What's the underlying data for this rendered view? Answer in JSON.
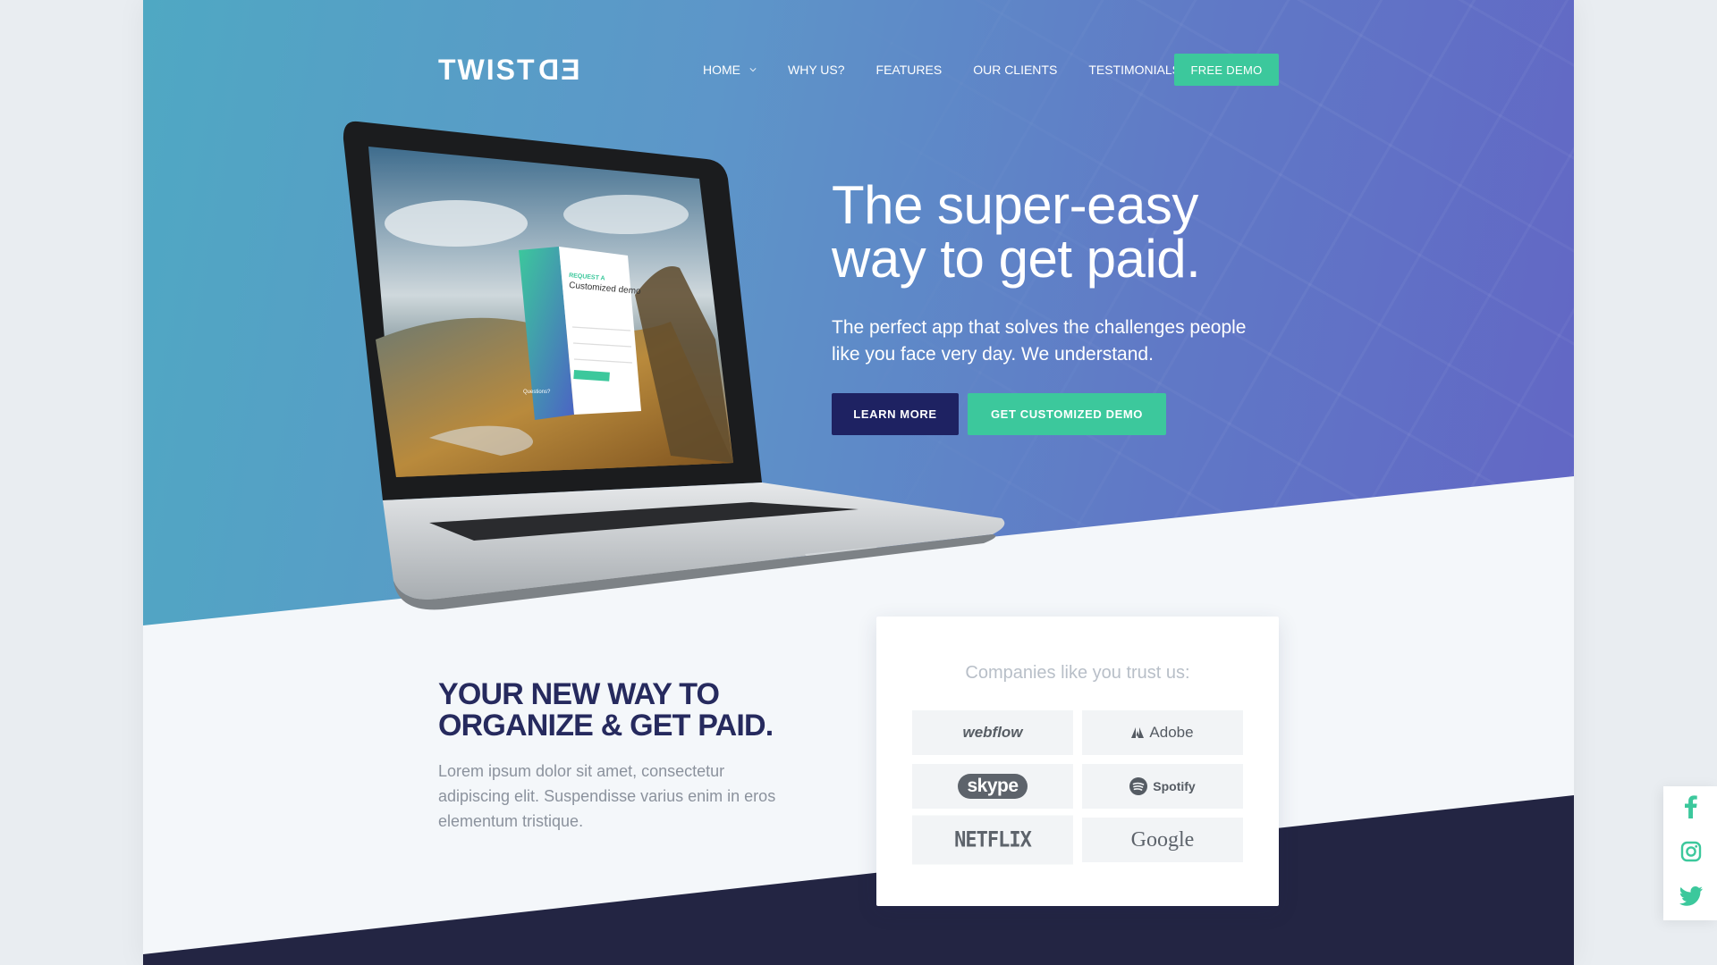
{
  "brand": {
    "logo_prefix": "TWIST",
    "logo_flipped": "ED"
  },
  "nav": {
    "items": [
      "HOME",
      "WHY US?",
      "FEATURES",
      "OUR CLIENTS",
      "TESTIMONIALS"
    ],
    "cta": "FREE DEMO"
  },
  "hero": {
    "title_line1": "The super-easy",
    "title_line2": "way to get paid.",
    "subtitle": "The perfect app that solves the challenges people like you face very day. We understand.",
    "learn_more": "LEARN MORE",
    "demo_button": "GET CUSTOMIZED DEMO"
  },
  "laptop_screen": {
    "form_kicker": "REQUEST A",
    "form_title": "Customized demo",
    "questions": "Questions?"
  },
  "section": {
    "title_line1": "YOUR NEW WAY TO",
    "title_line2": "ORGANIZE & GET PAID.",
    "body": "Lorem ipsum dolor sit amet, consectetur adipiscing elit. Suspendisse varius enim in eros elementum tristique."
  },
  "trust": {
    "title": "Companies like you trust us:",
    "logos": [
      "webflow",
      "Adobe",
      "skype",
      "Spotify",
      "NETFLIX",
      "Google"
    ]
  },
  "social": [
    "facebook-icon",
    "instagram-icon",
    "twitter-icon"
  ],
  "colors": {
    "accent_green": "#3cc89c",
    "navy_button": "#1e2262",
    "dark_band": "#232543",
    "heading_navy": "#262a5e"
  }
}
